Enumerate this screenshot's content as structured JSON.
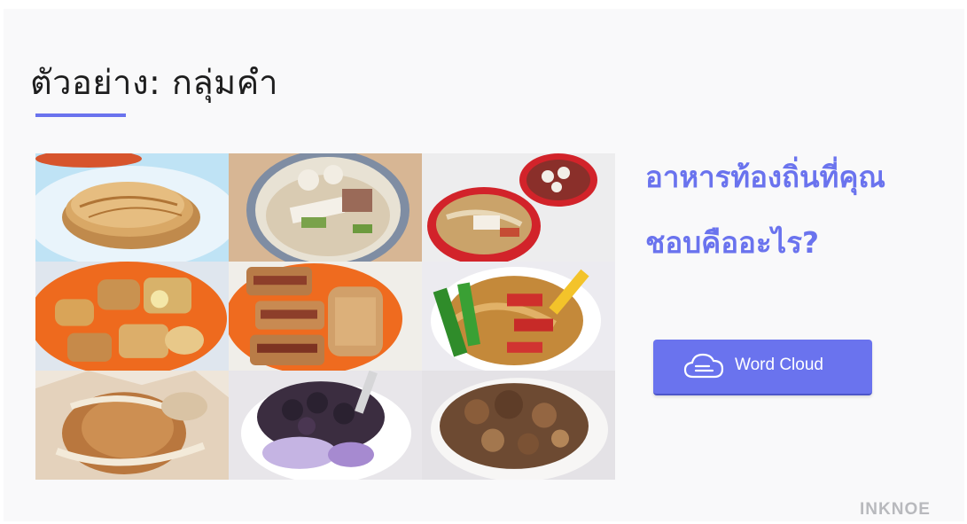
{
  "slide": {
    "title": "ตัวอย่าง: กลุ่มคำ",
    "question_line1": "อาหารท้องถิ่นที่คุณ",
    "question_line2": "ชอบคืออะไร?",
    "button_label": "Word Cloud",
    "button_icon": "cloud-icon",
    "brand": "INKNOE",
    "accent_color": "#6a73ee"
  },
  "food_photos": [
    {
      "row": 1,
      "col": 1,
      "subject": "roti-prata"
    },
    {
      "row": 1,
      "col": 2,
      "subject": "noodle-soup"
    },
    {
      "row": 1,
      "col": 3,
      "subject": "wanton-mee"
    },
    {
      "row": 2,
      "col": 1,
      "subject": "yong-tau-foo"
    },
    {
      "row": 2,
      "col": 2,
      "subject": "fried-sandwich"
    },
    {
      "row": 2,
      "col": 3,
      "subject": "char-siew-noodles"
    },
    {
      "row": 3,
      "col": 1,
      "subject": "paper-chicken"
    },
    {
      "row": 3,
      "col": 2,
      "subject": "ice-kacang"
    },
    {
      "row": 3,
      "col": 3,
      "subject": "braised-pork-rice"
    }
  ]
}
